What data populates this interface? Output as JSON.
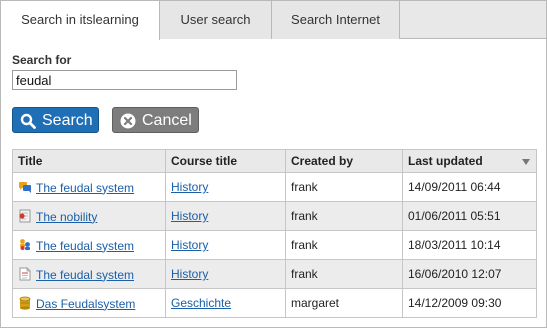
{
  "tabs": [
    {
      "label": "Search in itslearning",
      "active": true
    },
    {
      "label": "User search",
      "active": false
    },
    {
      "label": "Search Internet",
      "active": false
    }
  ],
  "search": {
    "label": "Search for",
    "value": "feudal"
  },
  "buttons": {
    "search_label": "Search",
    "cancel_label": "Cancel"
  },
  "table": {
    "headers": [
      "Title",
      "Course title",
      "Created by",
      "Last updated"
    ],
    "sort_column": "Last updated",
    "rows": [
      {
        "icon": "discussion-icon",
        "title": "The feudal system",
        "course": "History",
        "created_by": "frank",
        "updated": "14/09/2011 06:44"
      },
      {
        "icon": "assignment-icon",
        "title": "The nobility",
        "course": "History",
        "created_by": "frank",
        "updated": "01/06/2011 05:51"
      },
      {
        "icon": "group-icon",
        "title": "The feudal system",
        "course": "History",
        "created_by": "frank",
        "updated": "18/03/2011 10:14"
      },
      {
        "icon": "document-icon",
        "title": "The feudal system",
        "course": "History",
        "created_by": "frank",
        "updated": "16/06/2010 12:07"
      },
      {
        "icon": "database-icon",
        "title": "Das Feudalsystem",
        "course": "Geschichte",
        "created_by": "margaret",
        "updated": "14/12/2009 09:30"
      }
    ]
  },
  "colors": {
    "primary_button": "#1f6fb6",
    "secondary_button": "#7d7d7d",
    "link": "#1a5fa8"
  }
}
